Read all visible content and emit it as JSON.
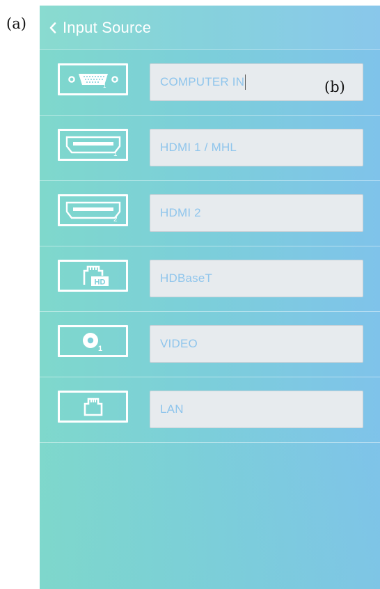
{
  "annotations": {
    "a": "(a)",
    "b": "(b)"
  },
  "header": {
    "title": "Input Source",
    "back_icon": "chevron-left-icon"
  },
  "sources": [
    {
      "label": "COMPUTER IN",
      "icon": "vga-port-icon",
      "focused": true
    },
    {
      "label": "HDMI 1 / MHL",
      "icon": "hdmi-port-icon",
      "port_number": "1"
    },
    {
      "label": "HDMI 2",
      "icon": "hdmi-port-icon",
      "port_number": "2"
    },
    {
      "label": "HDBaseT",
      "icon": "hdbaset-port-icon",
      "badge": "HD"
    },
    {
      "label": "VIDEO",
      "icon": "video-port-icon",
      "port_number": "1"
    },
    {
      "label": "LAN",
      "icon": "lan-port-icon"
    }
  ],
  "colors": {
    "gradient_left": "#7fd8cc",
    "gradient_right": "#7fc3ea",
    "field_background": "#e7ebee",
    "field_text": "#8fc5ec",
    "icon_stroke": "#ffffff"
  }
}
